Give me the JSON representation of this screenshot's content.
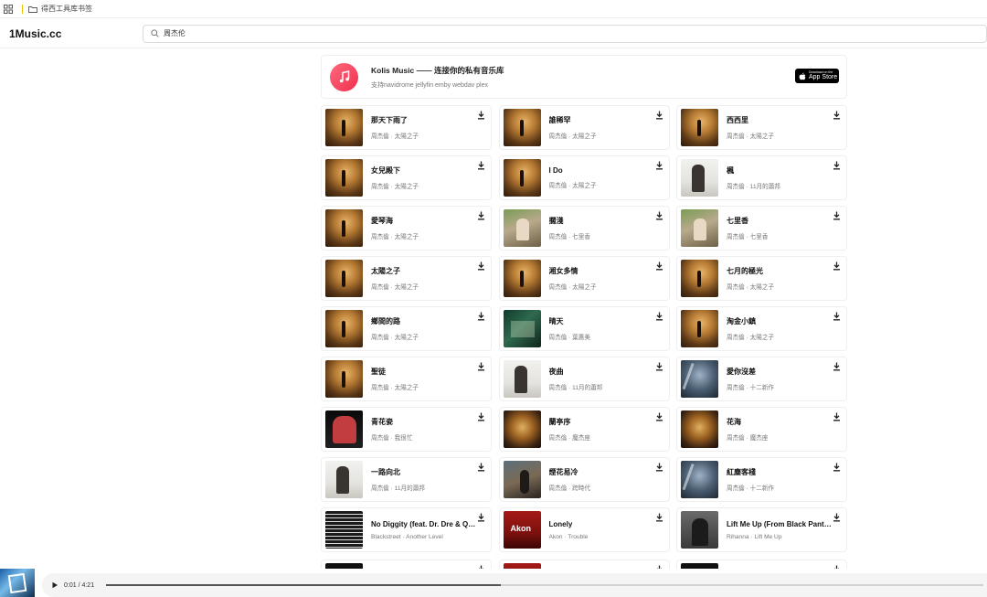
{
  "bookmarks_bar": {
    "folder_label": "得西工具库书签"
  },
  "header": {
    "logo": "1Music.cc",
    "search_value": "周杰伦"
  },
  "promo": {
    "title": "Kolis Music —— 连接你的私有音乐库",
    "subtitle": "支持navidrome jellyfin emby webdav plex",
    "badge_small": "Download on the",
    "badge_big": "App Store"
  },
  "songs": [
    {
      "title": "那天下雨了",
      "artist": "周杰倫",
      "album": "太陽之子",
      "cover": "sun"
    },
    {
      "title": "誰稀罕",
      "artist": "周杰倫",
      "album": "太陽之子",
      "cover": "sun"
    },
    {
      "title": "西西里",
      "artist": "周杰倫",
      "album": "太陽之子",
      "cover": "sun"
    },
    {
      "title": "女兒殿下",
      "artist": "周杰倫",
      "album": "太陽之子",
      "cover": "sun"
    },
    {
      "title": "I Do",
      "artist": "周杰倫",
      "album": "太陽之子",
      "cover": "sun"
    },
    {
      "title": "楓",
      "artist": "周杰倫",
      "album": "11月的蕭邦",
      "cover": "nov"
    },
    {
      "title": "愛琴海",
      "artist": "周杰倫",
      "album": "太陽之子",
      "cover": "sun"
    },
    {
      "title": "擱淺",
      "artist": "周杰倫",
      "album": "七里香",
      "cover": "qlx"
    },
    {
      "title": "七里香",
      "artist": "周杰倫",
      "album": "七里香",
      "cover": "qlx"
    },
    {
      "title": "太陽之子",
      "artist": "周杰倫",
      "album": "太陽之子",
      "cover": "sun"
    },
    {
      "title": "湘女多情",
      "artist": "周杰倫",
      "album": "太陽之子",
      "cover": "sun"
    },
    {
      "title": "七月的極光",
      "artist": "周杰倫",
      "album": "太陽之子",
      "cover": "sun"
    },
    {
      "title": "鄉間的路",
      "artist": "周杰倫",
      "album": "太陽之子",
      "cover": "sun"
    },
    {
      "title": "晴天",
      "artist": "周杰倫",
      "album": "葉惠美",
      "cover": "yhm"
    },
    {
      "title": "淘金小鎮",
      "artist": "周杰倫",
      "album": "太陽之子",
      "cover": "sun"
    },
    {
      "title": "聖徒",
      "artist": "周杰倫",
      "album": "太陽之子",
      "cover": "sun"
    },
    {
      "title": "夜曲",
      "artist": "周杰倫",
      "album": "11月的蕭邦",
      "cover": "nov"
    },
    {
      "title": "愛你沒差",
      "artist": "周杰倫",
      "album": "十二新作",
      "cover": "twelve"
    },
    {
      "title": "青花瓷",
      "artist": "周杰倫",
      "album": "我很忙",
      "cover": "wbm"
    },
    {
      "title": "蘭亭序",
      "artist": "周杰倫",
      "album": "魔杰座",
      "cover": "mjz"
    },
    {
      "title": "花海",
      "artist": "周杰倫",
      "album": "魔杰座",
      "cover": "mjz"
    },
    {
      "title": "一路向北",
      "artist": "周杰倫",
      "album": "11月的蕭邦",
      "cover": "nov"
    },
    {
      "title": "煙花易冷",
      "artist": "周杰倫",
      "album": "跨時代",
      "cover": "kdz"
    },
    {
      "title": "紅塵客棧",
      "artist": "周杰倫",
      "album": "十二新作",
      "cover": "twelve"
    },
    {
      "title": "No Diggity (feat. Dr. Dre & Queen Pen)",
      "artist": "Blackstreet",
      "album": "Another Level",
      "cover": "bs"
    },
    {
      "title": "Lonely",
      "artist": "Akon",
      "album": "Trouble",
      "cover": "akon"
    },
    {
      "title": "Lift Me Up (From Black Panther: Wakanda Forever)",
      "artist": "Rihanna",
      "album": "Lift Me Up",
      "cover": "rih"
    }
  ],
  "player": {
    "time": "0:01 / 4:21",
    "progress": 0.45
  }
}
